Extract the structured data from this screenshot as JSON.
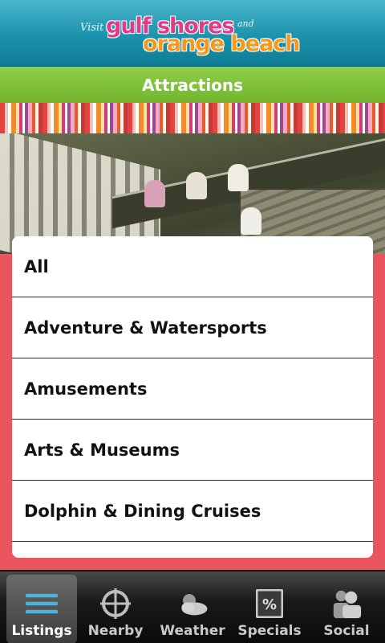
{
  "header": {
    "logo_visit": "Visit",
    "logo_line1": "gulf shores",
    "logo_and": "and",
    "logo_line2": "orange beach"
  },
  "page_title": "Attractions",
  "categories": [
    "All",
    "Adventure & Watersports",
    "Amusements",
    "Arts & Museums",
    "Dolphin & Dining Cruises"
  ],
  "tabs": [
    {
      "label": "Listings",
      "icon": "list-icon",
      "active": true
    },
    {
      "label": "Nearby",
      "icon": "crosshair-icon",
      "active": false
    },
    {
      "label": "Weather",
      "icon": "cloud-sun-icon",
      "active": false
    },
    {
      "label": "Specials",
      "icon": "percent-tag-icon",
      "active": false
    },
    {
      "label": "Social",
      "icon": "people-icon",
      "active": false
    }
  ],
  "colors": {
    "header": "#1c93ad",
    "title_bar": "#80c23a",
    "list_background": "#e9545e",
    "logo_pink": "#e23a8a",
    "logo_orange": "#f39a1e"
  }
}
